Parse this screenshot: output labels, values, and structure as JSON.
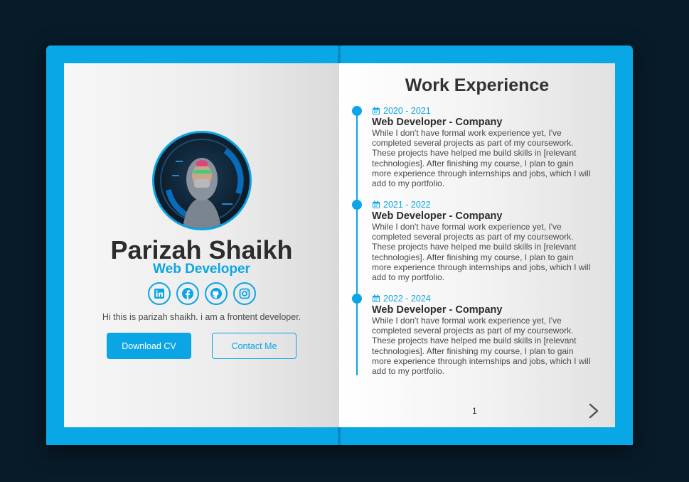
{
  "profile": {
    "name": "Parizah Shaikh",
    "role": "Web Developer",
    "bio": "Hi this is parizah shaikh. i am a frontent developer.",
    "socials": [
      "linkedin-icon",
      "facebook-icon",
      "github-icon",
      "instagram-icon"
    ],
    "download_cv_label": "Download CV",
    "contact_label": "Contact Me"
  },
  "experience": {
    "title": "Work Experience",
    "items": [
      {
        "date": "2020 - 2021",
        "title": "Web Developer - Company",
        "description": "While I don't have formal work experience yet, I've completed several projects as part of my coursework. These projects have helped me build skills in [relevant technologies]. After finishing my course, I plan to gain more experience through internships and jobs, which I will add to my portfolio."
      },
      {
        "date": "2021 - 2022",
        "title": "Web Developer - Company",
        "description": "While I don't have formal work experience yet, I've completed several projects as part of my coursework. These projects have helped me build skills in [relevant technologies]. After finishing my course, I plan to gain more experience through internships and jobs, which I will add to my portfolio."
      },
      {
        "date": "2022 - 2024",
        "title": "Web Developer - Company",
        "description": "While I don't have formal work experience yet, I've completed several projects as part of my coursework. These projects have helped me build skills in [relevant technologies]. After finishing my course, I plan to gain more experience through internships and jobs, which I will add to my portfolio."
      }
    ],
    "page_number": "1"
  },
  "colors": {
    "accent": "#0ba5e6",
    "background": "#081b29",
    "text": "#2d2d2d"
  }
}
